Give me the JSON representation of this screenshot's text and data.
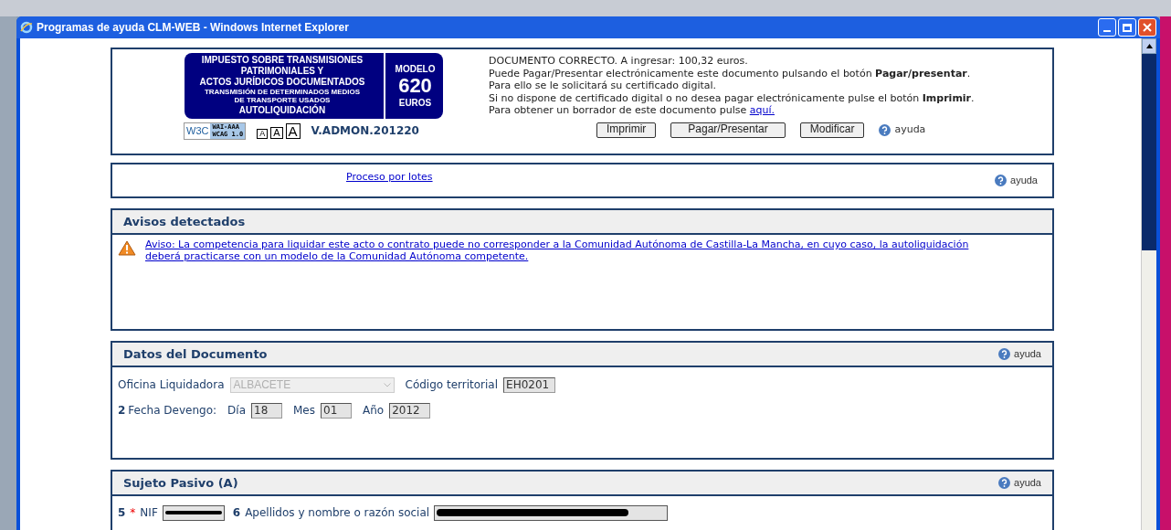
{
  "window": {
    "title": "Programas de ayuda CLM-WEB - Windows Internet Explorer"
  },
  "header": {
    "logo_lines": [
      "IMPUESTO SOBRE TRANSMISIONES",
      "PATRIMONIALES Y",
      "ACTOS JURÍDICOS DOCUMENTADOS"
    ],
    "logo_sub": [
      "TRANSMISIÓN DE DETERMINADOS MEDIOS",
      "DE TRANSPORTE USADOS"
    ],
    "logo_footer": "AUTOLIQUIDACIÓN",
    "model_label": "MODELO",
    "model_number": "620",
    "model_currency": "EUROS",
    "w3c": "W3C",
    "wai": [
      "WAI-AAA",
      "WCAG 1.0"
    ],
    "font_sizes": [
      "A",
      "A",
      "A"
    ],
    "version": "V.ADMON.201220",
    "message_lines": [
      "DOCUMENTO CORRECTO. A ingresar: 100,32 euros.",
      "Puede Pagar/Presentar electrónicamente este documento pulsando el botón **Pagar/presentar**.",
      "Para ello se le solicitará su certificado digital.",
      "Si no dispone de certificado digital o no desea pagar electrónicamente pulse el botón **Imprimir**."
    ],
    "draft_text": "Para obtener un borrador de este documento pulse",
    "draft_link": "aquí.",
    "buttons": [
      "Imprimir",
      "Pagar/Presentar",
      "Modificar"
    ],
    "help": "ayuda"
  },
  "batch": {
    "link": "Proceso por lotes",
    "help": "ayuda"
  },
  "notices": {
    "title": "Avisos detectados",
    "items": [
      {
        "text": "Aviso: La competencia para liquidar este acto o contrato puede no corresponder a la Comunidad Autónoma de Castilla-La Mancha, en cuyo caso, la autoliquidación deberá practicarse con un modelo de la Comunidad Autónoma competente."
      }
    ]
  },
  "document": {
    "title": "Datos del Documento",
    "help": "ayuda",
    "office_label": "Oficina Liquidadora",
    "office_value": "ALBACETE",
    "office_disabled": true,
    "territory_label": "Código territorial",
    "territory_value": "EH0201",
    "date_number": "2",
    "date_label": "Fecha Devengo:",
    "date_fields": [
      {
        "label": "Día",
        "value": "18"
      },
      {
        "label": "Mes",
        "value": "01"
      },
      {
        "label": "Año",
        "value": "2012"
      }
    ]
  },
  "subject": {
    "title": "Sujeto Pasivo (A)",
    "help": "ayuda",
    "nif_number": "5",
    "required_mark": "*",
    "nif_label": "NIF",
    "name_number": "6",
    "name_label": "Apellidos y nombre o razón social"
  }
}
